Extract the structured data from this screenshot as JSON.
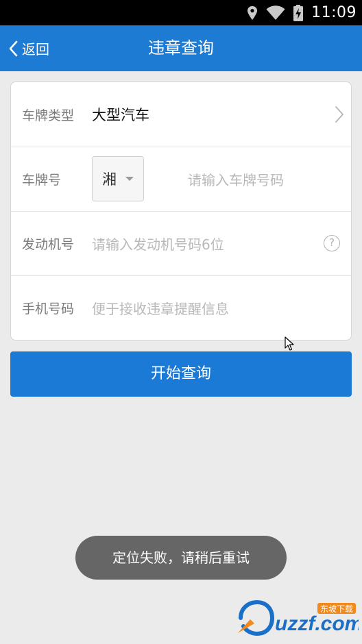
{
  "status_bar": {
    "time": "11:09",
    "icons": [
      "location-icon",
      "wifi-icon",
      "battery-charging-icon"
    ]
  },
  "app_bar": {
    "back_label": "返回",
    "title": "违章查询"
  },
  "form": {
    "plate_type": {
      "label": "车牌类型",
      "value": "大型汽车"
    },
    "plate_number": {
      "label": "车牌号",
      "province": "湘",
      "placeholder": "请输入车牌号码"
    },
    "engine_number": {
      "label": "发动机号",
      "placeholder": "请输入发动机号码6位",
      "help": "?"
    },
    "phone": {
      "label": "手机号码",
      "placeholder": "便于接收违章提醒信息"
    }
  },
  "submit_label": "开始查询",
  "toast": "定位失败，请稍后重试",
  "watermark": {
    "text": "uzzf.com",
    "sub": "东坡下载"
  },
  "colors": {
    "primary": "#1e7bd4",
    "button": "#1a7ad6",
    "background": "#ebebeb",
    "toast_bg": "#5a5a5a"
  }
}
